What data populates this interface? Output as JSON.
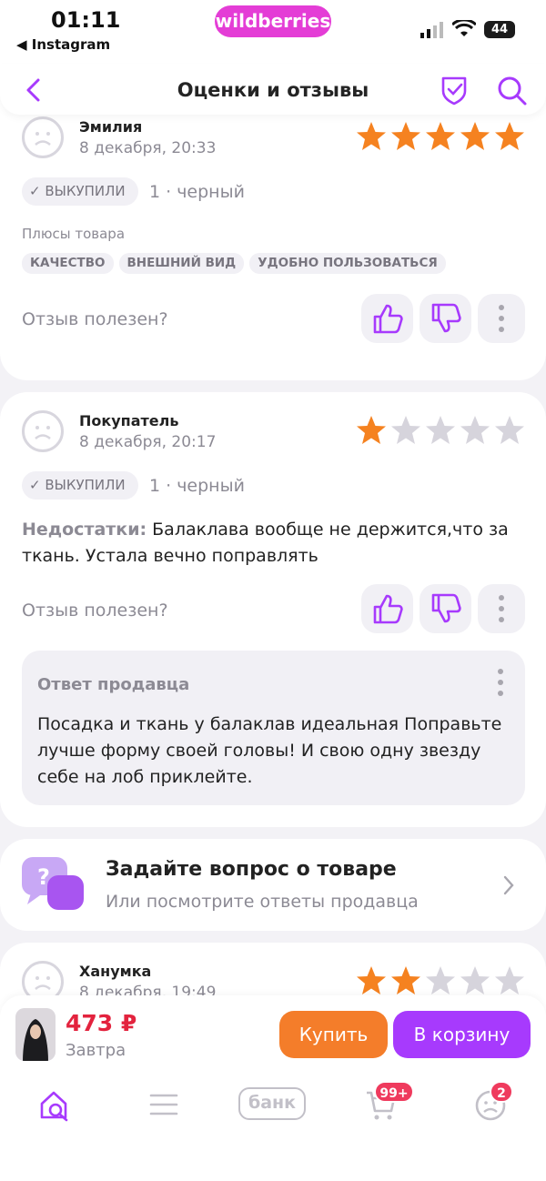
{
  "status_bar": {
    "time": "01:11",
    "back_app": "◀ Instagram",
    "brand": "wildberries",
    "battery": "44"
  },
  "header": {
    "title": "Оценки и отзывы"
  },
  "reviews": [
    {
      "author": "Эмилия",
      "date": "8 декабря, 20:33",
      "rating": 5,
      "badge": "✓ ВЫКУПИЛИ",
      "variant": "1 · черный",
      "pros_label": "Плюсы товара",
      "tags": [
        "КАЧЕСТВО",
        "ВНЕШНИЙ ВИД",
        "УДОБНО ПОЛЬЗОВАТЬСЯ"
      ],
      "useful": "Отзыв полезен?"
    },
    {
      "author": "Покупатель",
      "date": "8 декабря, 20:17",
      "rating": 1,
      "badge": "✓ ВЫКУПИЛИ",
      "variant": "1 · черный",
      "cons_label": "Недостатки:",
      "cons_text": " Балаклава вообще не держится,что за ткань. Устала вечно поправлять",
      "useful": "Отзыв полезен?",
      "seller_reply": {
        "title": "Ответ продавца",
        "text": "Посадка и ткань у балаклав идеальная Поправьте лучше форму своей головы! И свою одну звезду себе на лоб приклейте."
      }
    },
    {
      "author": "Ханумка",
      "date": "8 декабря, 19:49",
      "rating": 2
    }
  ],
  "question": {
    "title": "Задайте вопрос о товаре",
    "subtitle": "Или посмотрите ответы продавца"
  },
  "purchase": {
    "price": "473 ₽",
    "delivery": "Завтра",
    "buy_label": "Купить",
    "cart_label": "В корзину"
  },
  "nav": {
    "bank_label": "банк",
    "cart_badge": "99+",
    "profile_badge": "2"
  },
  "colors": {
    "accent": "#a73afd",
    "star": "#f58220",
    "star_empty": "#d6d4dc",
    "buy": "#f47d2a",
    "price": "#e3233e"
  }
}
